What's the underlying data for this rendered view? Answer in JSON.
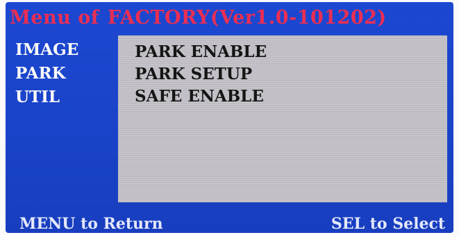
{
  "menu": {
    "title_prefix": "Menu of",
    "title_name": "FACTORY(Ver1.0-101202)"
  },
  "sidebar": {
    "items": [
      {
        "label": "IMAGE"
      },
      {
        "label": "PARK"
      },
      {
        "label": "UTIL"
      }
    ]
  },
  "panel": {
    "options": [
      {
        "label": "PARK ENABLE"
      },
      {
        "label": "PARK SETUP"
      },
      {
        "label": "SAFE ENABLE"
      }
    ]
  },
  "footer": {
    "left_hint": "MENU to Return",
    "right_hint": "SEL to Select"
  },
  "colors": {
    "screen_background": "#1a44cc",
    "title_text": "#ee2f55",
    "panel_background": "#c5c3c9",
    "menu_text": "#ffffff",
    "option_text": "#151515"
  }
}
